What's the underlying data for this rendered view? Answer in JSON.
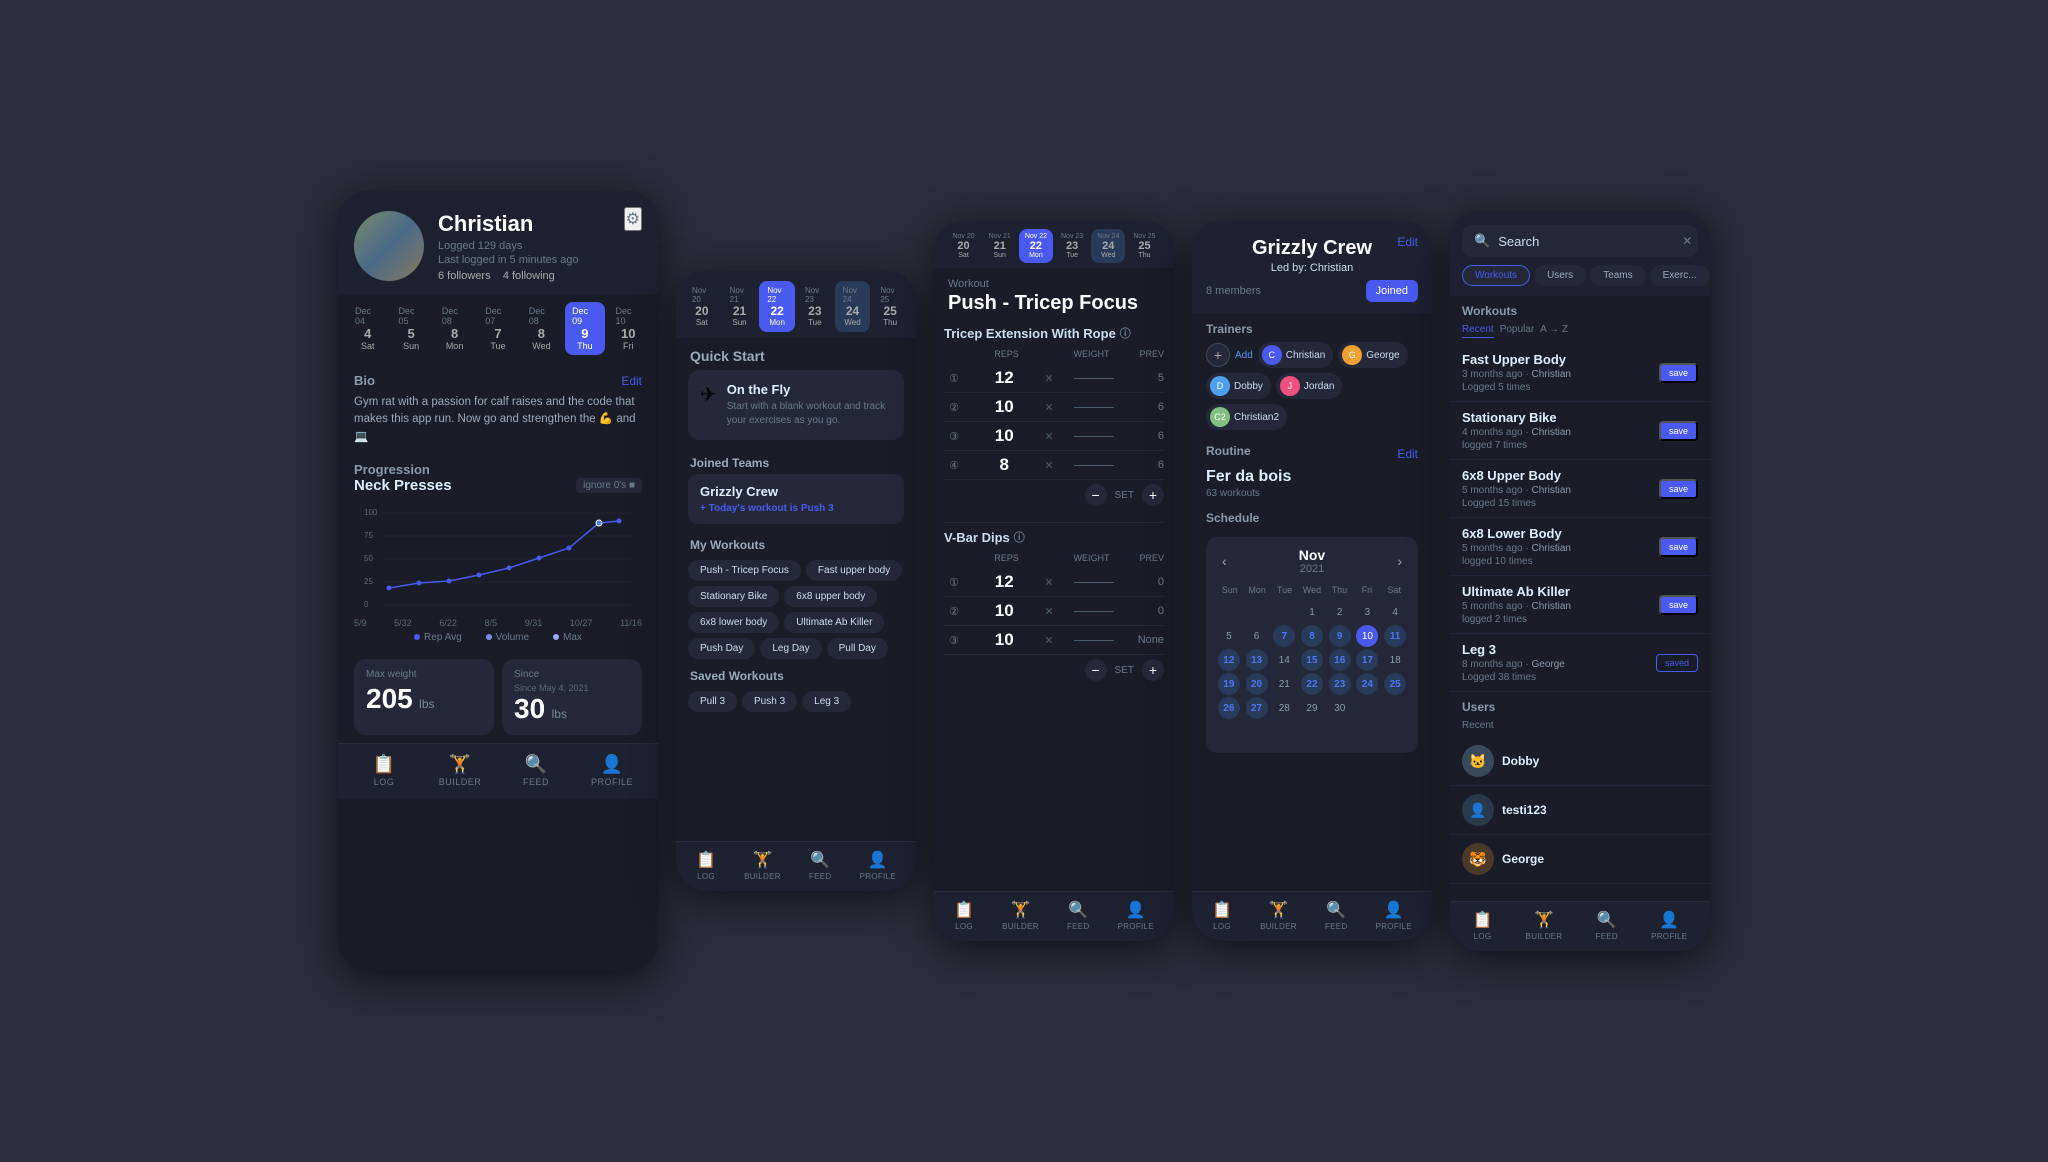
{
  "phone1": {
    "user": {
      "name": "Christian",
      "logged_days": "Logged 129 days",
      "last_login": "Last logged in 5 minutes ago",
      "followers": "6 followers",
      "following": "4 following"
    },
    "calendar": {
      "days": [
        {
          "date": "Dec 04",
          "dow": "Sat",
          "num": "4"
        },
        {
          "date": "Dec 05",
          "dow": "Sun",
          "num": "5"
        },
        {
          "date": "Dec 08",
          "dow": "Mon",
          "num": "8"
        },
        {
          "date": "Dec 07",
          "dow": "Tue",
          "num": "7"
        },
        {
          "date": "Dec 08",
          "dow": "Wed",
          "num": "8"
        },
        {
          "date": "Dec 09",
          "dow": "Thu",
          "num": "9",
          "active": true
        },
        {
          "date": "Dec 10",
          "dow": "Fri",
          "num": "10"
        }
      ]
    },
    "bio": {
      "title": "Bio",
      "text": "Gym rat with a passion for calf raises and the code that makes this app run. Now go and strengthen the 💪 and 💻"
    },
    "progression": {
      "title": "Progression",
      "workout": "Neck Presses",
      "ignore_label": "ignore 0's ■"
    },
    "chart": {
      "y_labels": [
        "100",
        "75",
        "50",
        "25",
        "0"
      ],
      "x_labels": [
        "5/9",
        "5/32",
        "6/22",
        "8/5",
        "9/31",
        "10/27",
        "11/16"
      ],
      "legend": [
        "Rep Avg",
        "Volume",
        "Max"
      ]
    },
    "stats": {
      "max_weight_label": "Max weight",
      "max_weight_value": "205",
      "max_weight_unit": "lbs",
      "since_label": "Since May 4, 2021",
      "since_value": "30",
      "since_unit": "lbs"
    },
    "nav": [
      "LOG",
      "BUILDER",
      "FEED",
      "PROFILE"
    ]
  },
  "phone2": {
    "calendar": {
      "days": [
        {
          "date": "Nov 20",
          "dow": "Sat",
          "num": "20"
        },
        {
          "date": "Nov 21",
          "dow": "Sun",
          "num": "21"
        },
        {
          "date": "Nov 22",
          "dow": "Mon",
          "num": "22",
          "active": true
        },
        {
          "date": "Nov 23",
          "dow": "Tue",
          "num": "23"
        },
        {
          "date": "Nov 24",
          "dow": "Wed",
          "num": "24",
          "highlighted": true
        },
        {
          "date": "Nov 25",
          "dow": "Thu",
          "num": "25"
        }
      ]
    },
    "quick_start": {
      "title": "Quick Start",
      "card_title": "On the Fly",
      "card_desc": "Start with a blank workout and track your exercises as you go."
    },
    "joined_teams": {
      "title": "Joined Teams",
      "team_name": "Grizzly Crew",
      "workout_label": "Today's workout is",
      "workout_name": "Push 3"
    },
    "my_workouts": {
      "title": "My Workouts",
      "items": [
        "Push - Tricep Focus",
        "Fast upper body",
        "Stationary Bike",
        "6x8 upper body",
        "6x8 lower body",
        "Ultimate Ab Killer",
        "Push Day",
        "Leg Day",
        "Pull Day"
      ]
    },
    "saved_workouts": {
      "title": "Saved Workouts",
      "items": [
        "Pull 3",
        "Push 3",
        "Leg 3"
      ]
    },
    "nav": [
      "LOG",
      "BUILDER",
      "FEED",
      "PROFILE"
    ]
  },
  "phone3": {
    "calendar": {
      "days": [
        {
          "date": "Nov 20",
          "dow": "Sat",
          "num": "20"
        },
        {
          "date": "Nov 21",
          "dow": "Sun",
          "num": "21"
        },
        {
          "date": "Nov 22",
          "dow": "Mon",
          "num": "22",
          "active": true
        },
        {
          "date": "Nov 23",
          "dow": "Tue",
          "num": "23"
        },
        {
          "date": "Nov 24",
          "dow": "Wed",
          "num": "24",
          "highlighted": true
        },
        {
          "date": "Nov 25",
          "dow": "Thu",
          "num": "25"
        }
      ]
    },
    "workout_label": "Workout",
    "workout_title": "Push - Tricep Focus",
    "exercises": [
      {
        "name": "Tricep Extension With Rope",
        "sets": [
          {
            "num": 1,
            "reps": 12,
            "weight": "",
            "prev": 5
          },
          {
            "num": 2,
            "reps": 10,
            "weight": "",
            "prev": 6
          },
          {
            "num": 3,
            "reps": 10,
            "weight": "",
            "prev": 6
          },
          {
            "num": 4,
            "reps": 8,
            "weight": "",
            "prev": 6
          }
        ]
      },
      {
        "name": "V-Bar Dips",
        "sets": [
          {
            "num": 1,
            "reps": 12,
            "weight": "",
            "prev": 0
          },
          {
            "num": 2,
            "reps": 10,
            "weight": "",
            "prev": 0
          },
          {
            "num": 3,
            "reps": 10,
            "weight": "",
            "prev": "None"
          }
        ]
      }
    ],
    "headers": {
      "reps": "REPS",
      "weight": "WEIGHT",
      "prev": "PREV"
    },
    "nav": [
      "LOG",
      "BUILDER",
      "FEED",
      "PROFILE"
    ]
  },
  "phone4": {
    "team_name": "Grizzly Crew",
    "led_by_label": "Led by:",
    "led_by": "Christian",
    "members_count": "8 members",
    "join_label": "Joined",
    "trainers_title": "Trainers",
    "trainers": [
      {
        "name": "Christian",
        "color": "#4a5af0"
      },
      {
        "name": "George",
        "color": "#f0a030"
      },
      {
        "name": "Dobby",
        "color": "#50a0f0"
      },
      {
        "name": "Jordan",
        "color": "#f05080"
      },
      {
        "name": "Christian2",
        "color": "#80f080"
      }
    ],
    "add_label": "+",
    "add_text": "Add",
    "routine_title": "Routine",
    "routine_name": "Fer da bois",
    "routine_count": "63 workouts",
    "schedule_title": "Schedule",
    "edit_label": "Edit",
    "calendar": {
      "month": "Nov",
      "year": "2021",
      "dows": [
        "Sun",
        "Mon",
        "Tue",
        "Wed",
        "Thu",
        "Fri",
        "Sat"
      ],
      "weeks": [
        [
          "",
          "",
          "",
          "1",
          "2",
          "3",
          "4",
          "5",
          "6"
        ],
        [
          "7",
          "8",
          "9",
          "10",
          "11",
          "12",
          "13"
        ],
        [
          "14",
          "15",
          "16",
          "17",
          "18",
          "19",
          "20"
        ],
        [
          "21",
          "22",
          "23",
          "24",
          "25",
          "26",
          "27"
        ],
        [
          "28",
          "29",
          "30",
          "",
          "",
          "",
          ""
        ]
      ],
      "highlighted": [
        "7",
        "8",
        "9",
        "11",
        "12",
        "13",
        "15",
        "16",
        "17",
        "19",
        "20",
        "22",
        "23",
        "24",
        "25",
        "26",
        "27"
      ],
      "today": "10"
    },
    "nav": [
      "LOG",
      "BUILDER",
      "FEED",
      "PROFILE"
    ]
  },
  "phone5": {
    "search": {
      "placeholder": "Search",
      "value": "Search"
    },
    "filter_tabs": [
      "Workouts",
      "Users",
      "Teams",
      "Exerc..."
    ],
    "active_filter": "Workouts",
    "workouts_section": "Workouts",
    "workouts_recent_label": "Recent",
    "workouts_popular_label": "Popular",
    "workouts_az_label": "A → Z",
    "workouts": [
      {
        "name": "Fast Upper Body",
        "meta": "3 months ago · Christian",
        "logged": "Logged 5 times",
        "action": "save"
      },
      {
        "name": "Stationary Bike",
        "meta": "4 months ago · Christian",
        "logged": "logged 7 times",
        "action": "save"
      },
      {
        "name": "6x8 Upper Body",
        "meta": "5 months ago · Christian",
        "logged": "Logged 15 times",
        "action": "save"
      },
      {
        "name": "6x8 Lower Body",
        "meta": "5 months ago · Christian",
        "logged": "logged 10 times",
        "action": "save"
      },
      {
        "name": "Ultimate Ab Killer",
        "meta": "5 months ago · Christian",
        "logged": "logged 2 times",
        "action": "save"
      },
      {
        "name": "Leg 3",
        "meta": "8 months ago · George",
        "logged": "Logged 38 times",
        "action": "saved"
      }
    ],
    "users_section": "Users",
    "recent_label": "Recent",
    "users": [
      {
        "name": "Dobby",
        "emoji": "🐱"
      },
      {
        "name": "testi123",
        "emoji": "👤"
      },
      {
        "name": "George",
        "emoji": "🐯"
      }
    ],
    "nav": [
      "LOG",
      "BUILDER",
      "FEED",
      "PROFILE"
    ]
  }
}
